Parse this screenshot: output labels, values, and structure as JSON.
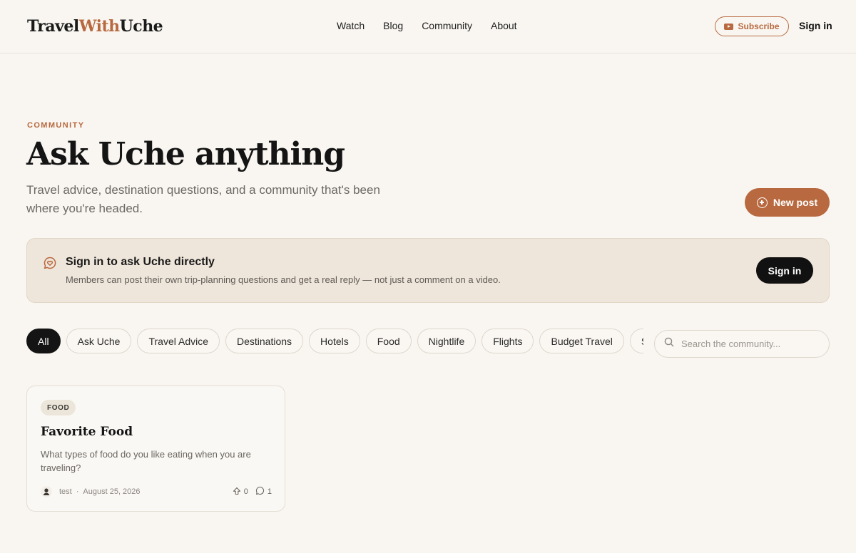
{
  "header": {
    "logo_part1": "Travel",
    "logo_part2": "With",
    "logo_part3": "Uche",
    "nav": [
      "Watch",
      "Blog",
      "Community",
      "About"
    ],
    "subscribe_label": "Subscribe",
    "signin_label": "Sign in"
  },
  "hero": {
    "eyebrow": "COMMUNITY",
    "title": "Ask Uche anything",
    "subtitle": "Travel advice, destination questions, and a community that's been where you're headed.",
    "new_post_label": "New post"
  },
  "banner": {
    "title": "Sign in to ask Uche directly",
    "description": "Members can post their own trip-planning questions and get a real reply — not just a comment on a video.",
    "button_label": "Sign in"
  },
  "filters": {
    "chips": [
      "All",
      "Ask Uche",
      "Travel Advice",
      "Destinations",
      "Hotels",
      "Food",
      "Nightlife",
      "Flights",
      "Budget Travel",
      "Sc"
    ],
    "active": "All",
    "search_placeholder": "Search the community..."
  },
  "posts": [
    {
      "tag": "FOOD",
      "title": "Favorite Food",
      "body": "What types of food do you like eating when you are traveling?",
      "author": "test",
      "separator": "·",
      "date": "August 25, 2026",
      "upvotes": "0",
      "comments": "1"
    }
  ],
  "colors": {
    "accent": "#b8693f",
    "background": "#f9f6f1",
    "banner_bg": "#efe6db",
    "dark": "#141414"
  },
  "icons": {
    "subscribe": "youtube-icon",
    "new_post": "plus-circle-icon",
    "banner": "heart-chat-icon",
    "search": "search-icon",
    "upvote": "upvote-icon",
    "comments": "comment-icon"
  }
}
